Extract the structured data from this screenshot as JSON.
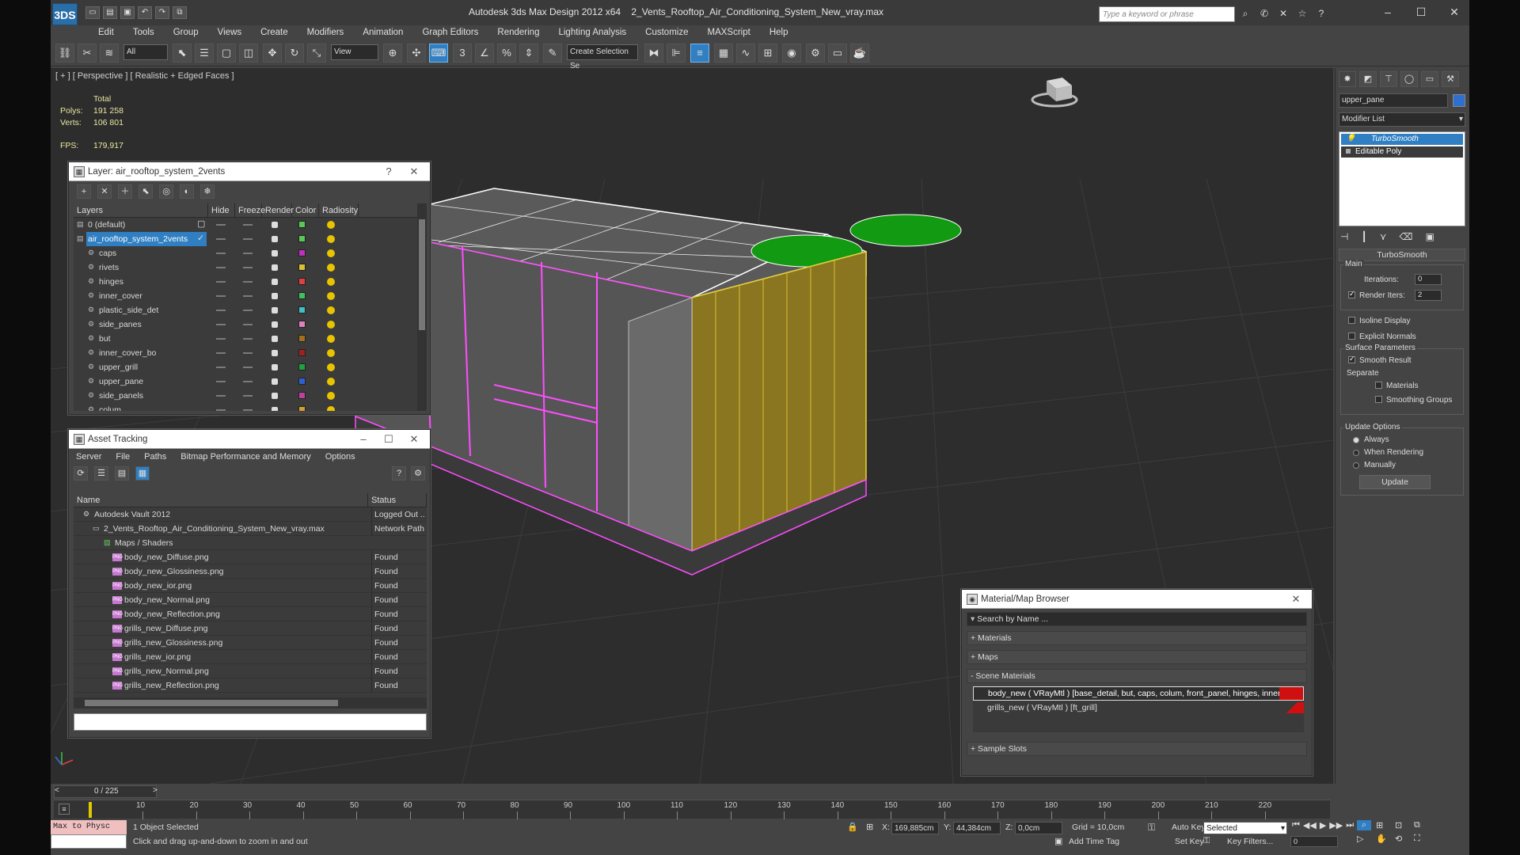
{
  "app": {
    "logo": "3DS",
    "title": "Autodesk 3ds Max Design 2012 x64",
    "file": "2_Vents_Rooftop_Air_Conditioning_System_New_vray.max",
    "search_placeholder": "Type a keyword or phrase"
  },
  "menu": [
    "Edit",
    "Tools",
    "Group",
    "Views",
    "Create",
    "Modifiers",
    "Animation",
    "Graph Editors",
    "Rendering",
    "Lighting Analysis",
    "Customize",
    "MAXScript",
    "Help"
  ],
  "toolbar": {
    "filter": "All",
    "refcoord": "View",
    "selset": "Create Selection Se"
  },
  "viewport": {
    "label": "[ + ] [ Perspective ] [ Realistic + Edged Faces ]",
    "stats_header": "Total",
    "polys_label": "Polys:",
    "polys": "191 258",
    "verts_label": "Verts:",
    "verts": "106 801",
    "fps_label": "FPS:",
    "fps": "179,917"
  },
  "layer_win": {
    "title": "Layer: air_rooftop_system_2vents",
    "help": "?",
    "cols": [
      "Layers",
      "Hide",
      "Freeze",
      "Render",
      "Color",
      "Radiosity"
    ],
    "rows": [
      {
        "name": "0 (default)",
        "color": "#58c858"
      },
      {
        "name": "air_rooftop_system_2vents",
        "color": "#58c858"
      },
      {
        "name": "caps",
        "color": "#c030c0"
      },
      {
        "name": "rivets",
        "color": "#d8c030"
      },
      {
        "name": "hinges",
        "color": "#e04040"
      },
      {
        "name": "inner_cover",
        "color": "#40c060"
      },
      {
        "name": "plastic_side_det",
        "color": "#40c0c0"
      },
      {
        "name": "side_panes",
        "color": "#e080c0"
      },
      {
        "name": "but",
        "color": "#a07020"
      },
      {
        "name": "inner_cover_bo",
        "color": "#a02020"
      },
      {
        "name": "upper_grill",
        "color": "#20a040"
      },
      {
        "name": "upper_pane",
        "color": "#3060d0"
      },
      {
        "name": "side_panels",
        "color": "#c040a0"
      },
      {
        "name": "colum",
        "color": "#d0a030"
      }
    ]
  },
  "asset_win": {
    "title": "Asset Tracking",
    "menu": [
      "Server",
      "File",
      "Paths",
      "Bitmap Performance and Memory",
      "Options"
    ],
    "cols": [
      "Name",
      "Status"
    ],
    "rows": [
      {
        "name": "Autodesk Vault 2012",
        "status": "Logged Out ..."
      },
      {
        "name": "2_Vents_Rooftop_Air_Conditioning_System_New_vray.max",
        "status": "Network Path"
      },
      {
        "name": "Maps / Shaders",
        "status": ""
      },
      {
        "name": "body_new_Diffuse.png",
        "status": "Found"
      },
      {
        "name": "body_new_Glossiness.png",
        "status": "Found"
      },
      {
        "name": "body_new_ior.png",
        "status": "Found"
      },
      {
        "name": "body_new_Normal.png",
        "status": "Found"
      },
      {
        "name": "body_new_Reflection.png",
        "status": "Found"
      },
      {
        "name": "grills_new_Diffuse.png",
        "status": "Found"
      },
      {
        "name": "grills_new_Glossiness.png",
        "status": "Found"
      },
      {
        "name": "grills_new_ior.png",
        "status": "Found"
      },
      {
        "name": "grills_new_Normal.png",
        "status": "Found"
      },
      {
        "name": "grills_new_Reflection.png",
        "status": "Found"
      }
    ],
    "png_tag": "PNG"
  },
  "mat_win": {
    "title": "Material/Map Browser",
    "search": "Search by Name ...",
    "sections": [
      "+ Materials",
      "+ Maps",
      "- Scene Materials",
      "+ Sample Slots"
    ],
    "items": [
      "body_new ( VRayMtl ) [base_detail, but, caps, colum, front_panel, hinges, inner...",
      "grills_new ( VRayMtl ) [ft_grill]"
    ]
  },
  "cmd": {
    "object_name": "upper_pane",
    "modifier_list": "Modifier List",
    "stack": [
      "TurboSmooth",
      "Editable Poly"
    ],
    "rollout": "TurboSmooth",
    "main": "Main",
    "iterations_label": "Iterations:",
    "iterations": "0",
    "render_iters_label": "Render Iters:",
    "render_iters": "2",
    "isoline": "Isoline Display",
    "explicit": "Explicit Normals",
    "surface": "Surface Parameters",
    "smooth": "Smooth Result",
    "separate": "Separate",
    "materials": "Materials",
    "smoothing": "Smoothing Groups",
    "update_options": "Update Options",
    "always": "Always",
    "when_rendering": "When Rendering",
    "manually": "Manually",
    "update_btn": "Update"
  },
  "timeline": {
    "frame": "0 / 225",
    "ticks": [
      "10",
      "20",
      "30",
      "40",
      "50",
      "60",
      "70",
      "80",
      "90",
      "100",
      "110",
      "120",
      "130",
      "140",
      "150",
      "160",
      "170",
      "180",
      "190",
      "200",
      "210",
      "220"
    ]
  },
  "status": {
    "maxscript": "Max to Physc",
    "selected": "1 Object Selected",
    "prompt": "Click and drag up-and-down to zoom in and out",
    "x_label": "X:",
    "x": "169,885cm",
    "y_label": "Y:",
    "y": "44,384cm",
    "z_label": "Z:",
    "z": "0,0cm",
    "grid": "Grid = 10,0cm",
    "add_time_tag": "Add Time Tag",
    "auto_key": "Auto Key",
    "selected_dd": "Selected",
    "set_key": "Set Key",
    "key_filters": "Key Filters...",
    "frame_field": "0"
  }
}
